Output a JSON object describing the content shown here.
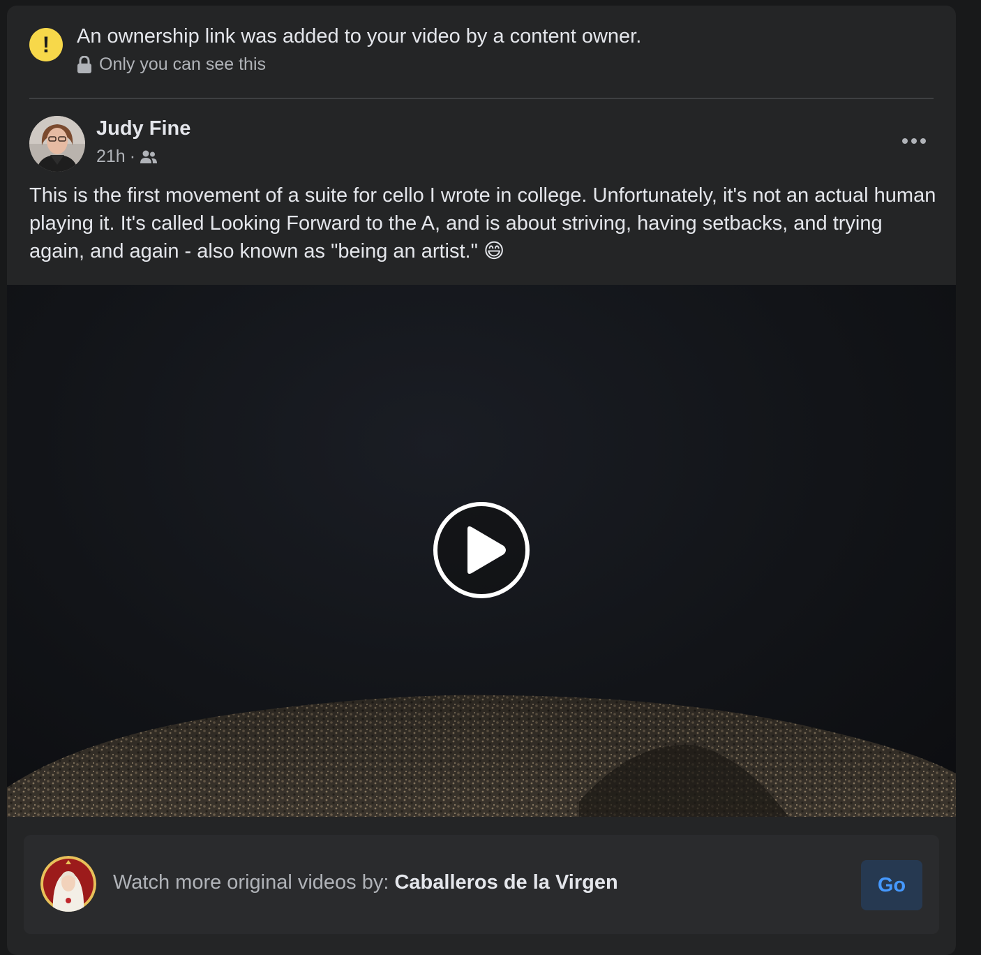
{
  "notice": {
    "title": "An ownership link was added to your video by a content owner.",
    "subtitle": "Only you can see this",
    "icon": "warning-icon",
    "accent": "#f7d84a"
  },
  "post": {
    "author": "Judy Fine",
    "time": "21h",
    "separator": "·",
    "audience_icon": "friends-icon",
    "text": "This is the first movement of a suite for cello I wrote in college. Unfortunately, it's not an actual human playing it. It's called Looking Forward to the A, and is about striving, having setbacks, and trying again, and again - also known as \"being an artist.\" 😄"
  },
  "video": {
    "play_icon": "play-icon"
  },
  "cta": {
    "prefix": "Watch more original videos by: ",
    "channel": "Caballeros de la Virgen",
    "button_label": "Go",
    "button_color": "#4599ff"
  }
}
